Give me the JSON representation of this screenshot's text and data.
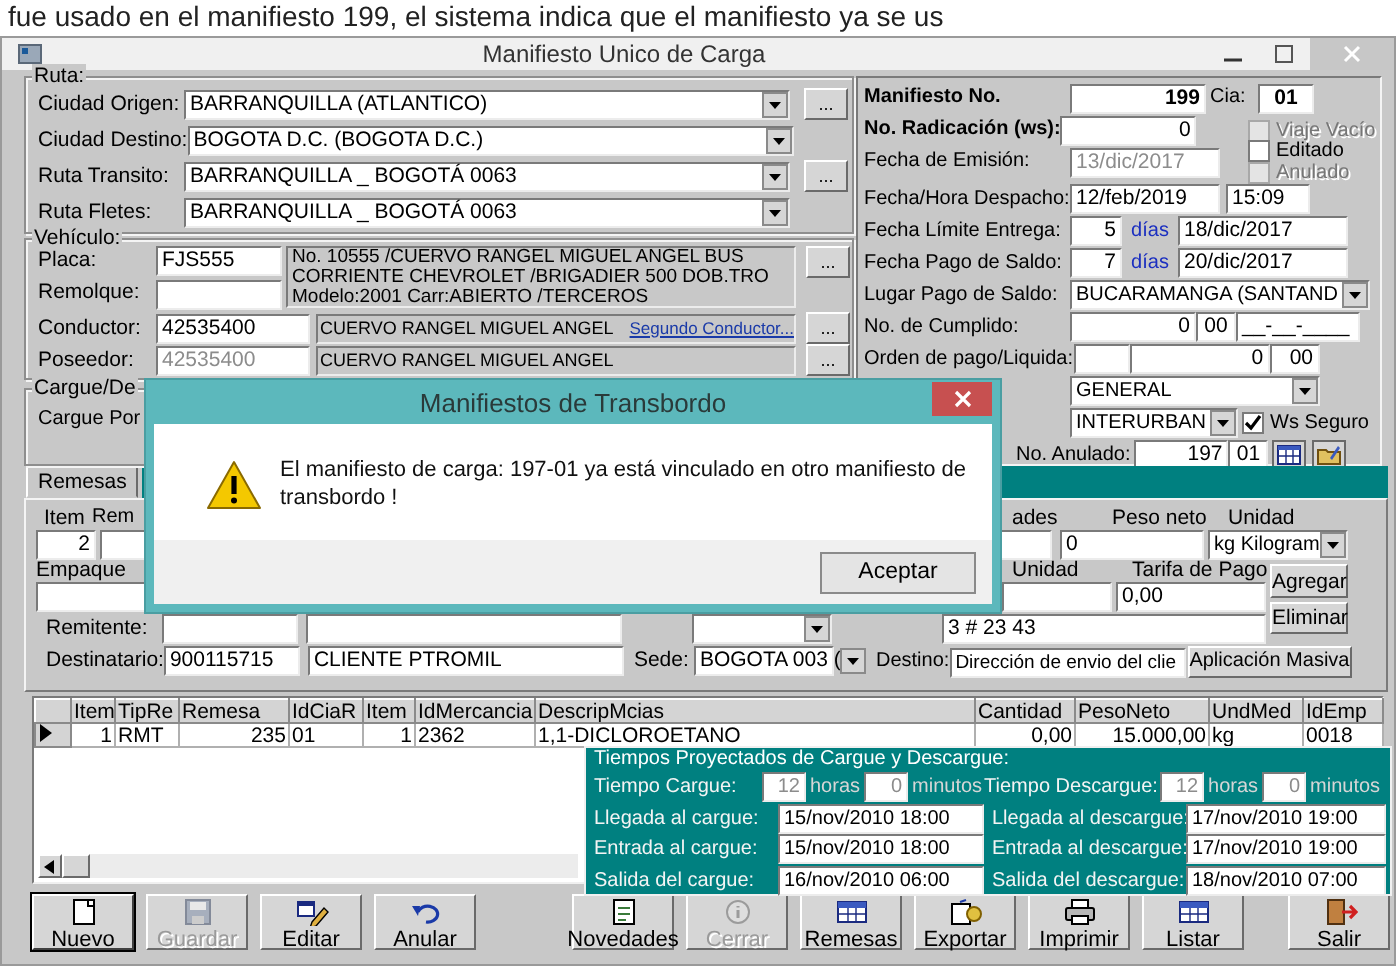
{
  "document_text": "fue usado en el manifiesto 199, el sistema indica que el manifiesto ya se us",
  "window": {
    "title": "Manifiesto Unico de Carga"
  },
  "ruta": {
    "legend": "Ruta:",
    "rows": [
      {
        "label": "Ciudad Origen:",
        "value": "BARRANQUILLA  (ATLANTICO)",
        "browse": "..."
      },
      {
        "label": "Ciudad Destino:",
        "value": "BOGOTA D.C.  (BOGOTA D.C.)"
      },
      {
        "label": "Ruta Transito:",
        "value": "BARRANQUILLA _ BOGOTÁ 0063",
        "browse": "..."
      },
      {
        "label": "Ruta Fletes:",
        "value": "BARRANQUILLA _ BOGOTÁ 0063"
      }
    ]
  },
  "vehiculo": {
    "legend": "Vehículo:",
    "placa": {
      "label": "Placa:",
      "value": "FJS555"
    },
    "remolque": {
      "label": "Remolque:"
    },
    "description": "No. 10555 /CUERVO RANGEL MIGUEL ANGEL BUS CORRIENTE CHEVROLET /BRIGADIER 500 DOB.TRO Modelo:2001 Carr:ABIERTO /TERCEROS",
    "browse": "...",
    "people": [
      {
        "label": "Conductor:",
        "id": "42535400",
        "name": "CUERVO RANGEL MIGUEL ANGEL",
        "disabled": false,
        "link": "Segundo Conductor...",
        "browse": "..."
      },
      {
        "label": "Poseedor:",
        "id": "42535400",
        "name": "CUERVO RANGEL MIGUEL ANGEL",
        "disabled": true,
        "browse": "..."
      }
    ]
  },
  "cargue": {
    "legend": "Cargue/De",
    "label": "Cargue Por"
  },
  "manifiesto": {
    "numero": {
      "label": "Manifiesto No.",
      "value": "199",
      "cia_label": "Cia:",
      "cia": "01"
    },
    "radicacion": {
      "label": "No. Radicación (ws):",
      "value": "0"
    },
    "emision": {
      "label": "Fecha de Emisión:",
      "value": "13/dic/2017",
      "disabled": true
    },
    "flags": [
      {
        "label": "Viaje Vacío",
        "checked": false,
        "disabled": true
      },
      {
        "label": "Editado",
        "checked": false,
        "disabled": false
      },
      {
        "label": "Anulado",
        "checked": false,
        "disabled": true
      }
    ],
    "despacho": {
      "label": "Fecha/Hora Despacho:",
      "date": "12/feb/2019",
      "time": "15:09"
    },
    "plazos": [
      {
        "label": "Fecha Límite Entrega:",
        "days": "5",
        "unit": "días",
        "date": "18/dic/2017"
      },
      {
        "label": "Fecha Pago de Saldo:",
        "days": "7",
        "unit": "días",
        "date": "20/dic/2017"
      }
    ],
    "lugar_pago": {
      "label": "Lugar Pago de Saldo:",
      "value": "BUCARAMANGA  (SANTAND"
    },
    "cumplido": {
      "label": "No. de Cumplido:",
      "number": "0",
      "cia": "00",
      "date": "__-__-____"
    },
    "orden_pago": {
      "label": "Orden de pago/Liquida:",
      "number": "0",
      "cia": "00"
    },
    "tipo": {
      "value": "GENERAL"
    },
    "tipo_viaje": {
      "value": "INTERURBAN"
    },
    "ws_seguro": {
      "label": "Ws Seguro",
      "checked": true
    },
    "anulado": {
      "label": "No. Anulado:",
      "number": "197",
      "cia": "01"
    }
  },
  "tabs": [
    {
      "label": "Remesas",
      "selected": true
    }
  ],
  "remesa": {
    "labels_top": [
      "Item",
      "Rem"
    ],
    "item": "2",
    "empaque_label": "Empaque",
    "remitente": {
      "label": "Remitente:"
    },
    "destinatario": {
      "label": "Destinatario:",
      "id": "900115715",
      "name": "CLIENTE PTROMIL",
      "sede_label": "Sede:",
      "sede": "BOGOTA 003 ("
    },
    "right_labels_top": [
      "ades",
      "Peso neto",
      "Unidad"
    ],
    "peso_neto": "0",
    "unidad": "kg  Kilogram",
    "right_labels_mid": [
      "Unidad",
      "Tarifa de Pago"
    ],
    "tarifa": "0,00",
    "direccion": "3 # 23 43",
    "destino": {
      "label": "Destino:",
      "value": "Dirección de envio del clie"
    },
    "buttons": [
      "Agregar",
      "Eliminar",
      "Aplicación Masiva"
    ]
  },
  "table": {
    "columns": [
      "Item",
      "TipRe",
      "Remesa",
      "IdCiaR",
      "Item",
      "IdMercancia",
      "DescripMcias",
      "Cantidad",
      "PesoNeto",
      "UndMed",
      "IdEmp"
    ],
    "rows": [
      {
        "selected": true,
        "cells": [
          "1",
          "RMT",
          "235",
          "01",
          "1",
          "2362",
          "1,1-DICLOROETANO",
          "0,00",
          "15.000,00",
          "kg",
          "0018"
        ]
      }
    ]
  },
  "tiempos": {
    "legend": "Tiempos Proyectados de Cargue y Descargue:",
    "durations": [
      {
        "label": "Tiempo Cargue:",
        "hours": "12",
        "hours_unit": "horas",
        "minutes": "0",
        "minutes_unit": "minutos",
        "disabled": true
      },
      {
        "label": "Tiempo Descargue:",
        "hours": "12",
        "hours_unit": "horas",
        "minutes": "0",
        "minutes_unit": "minutos",
        "disabled": true
      }
    ],
    "cargue": [
      {
        "label": "Llegada al cargue:",
        "value": "15/nov/2010 18:00"
      },
      {
        "label": "Entrada al cargue:",
        "value": "15/nov/2010 18:00"
      },
      {
        "label": "Salida del cargue:",
        "value": "16/nov/2010 06:00"
      }
    ],
    "descargue": [
      {
        "label": "Llegada al descargue:",
        "value": "17/nov/2010 19:00"
      },
      {
        "label": "Entrada al descargue:",
        "value": "17/nov/2010 19:00"
      },
      {
        "label": "Salida del descargue:",
        "value": "18/nov/2010 07:00"
      }
    ]
  },
  "toolbar": {
    "left": [
      {
        "label": "Nuevo",
        "kind": "document",
        "disabled": false,
        "default": true
      },
      {
        "label": "Guardar",
        "kind": "floppy",
        "disabled": true,
        "default": false
      },
      {
        "label": "Editar",
        "kind": "edit",
        "disabled": false,
        "default": false
      },
      {
        "label": "Anular",
        "kind": "undo",
        "disabled": false,
        "default": false
      }
    ],
    "middle": [
      {
        "label": "Novedades",
        "kind": "notepad",
        "disabled": false,
        "default": false
      },
      {
        "label": "Cerrar",
        "kind": "info",
        "disabled": true,
        "default": false
      },
      {
        "label": "Remesas",
        "kind": "grid",
        "disabled": false,
        "default": false
      },
      {
        "label": "Exportar",
        "kind": "export",
        "disabled": false,
        "default": false
      },
      {
        "label": "Imprimir",
        "kind": "printer",
        "disabled": false,
        "default": false
      },
      {
        "label": "Listar",
        "kind": "grid",
        "disabled": false,
        "default": false
      }
    ],
    "right": [
      {
        "label": "Salir",
        "kind": "exit",
        "disabled": false,
        "default": false
      }
    ]
  },
  "dialog": {
    "title": "Manifiestos de Transbordo",
    "message": "El manifiesto de carga: 197-01 ya está vinculado en otro manifiesto de transbordo !",
    "button": "Aceptar"
  }
}
